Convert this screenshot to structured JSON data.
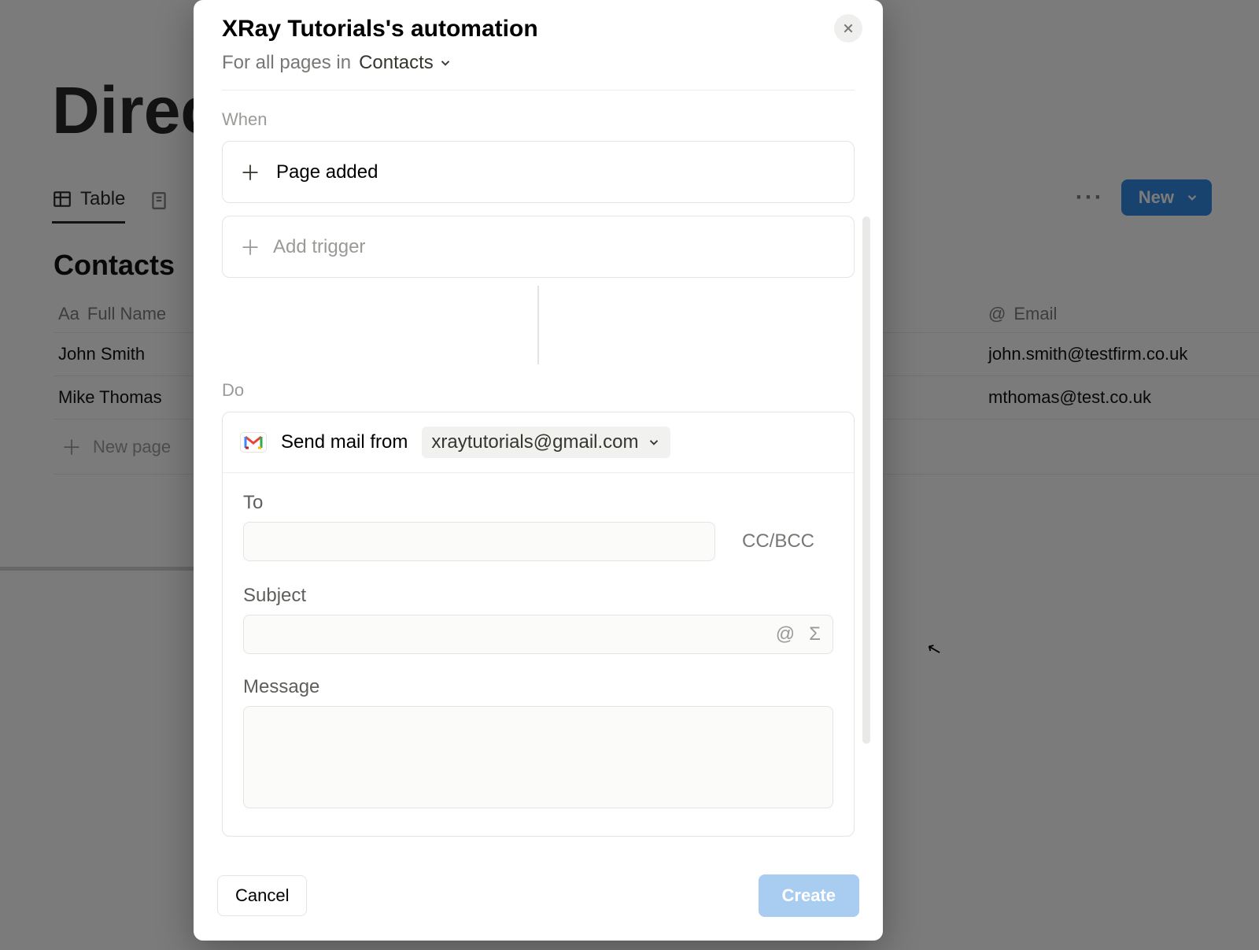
{
  "background": {
    "page_title": "Direct",
    "views": {
      "table": "Table"
    },
    "toolbar": {
      "new_label": "New"
    },
    "database": {
      "title": "Contacts",
      "columns": {
        "name": "Full Name",
        "email": "Email"
      },
      "rows": [
        {
          "name": "John Smith",
          "email": "john.smith@testfirm.co.uk"
        },
        {
          "name": "Mike Thomas",
          "email": "mthomas@test.co.uk"
        }
      ],
      "new_page": "New page"
    }
  },
  "modal": {
    "title": "XRay Tutorials's automation",
    "subtitle_prefix": "For all pages in",
    "subtitle_scope": "Contacts",
    "when": {
      "label": "When",
      "trigger": "Page added",
      "add_trigger": "Add trigger"
    },
    "do": {
      "label": "Do",
      "send_label": "Send mail from",
      "from_email": "xraytutorials@gmail.com",
      "to_label": "To",
      "ccbcc": "CC/BCC",
      "subject_label": "Subject",
      "message_label": "Message"
    },
    "footer": {
      "cancel": "Cancel",
      "create": "Create"
    }
  }
}
